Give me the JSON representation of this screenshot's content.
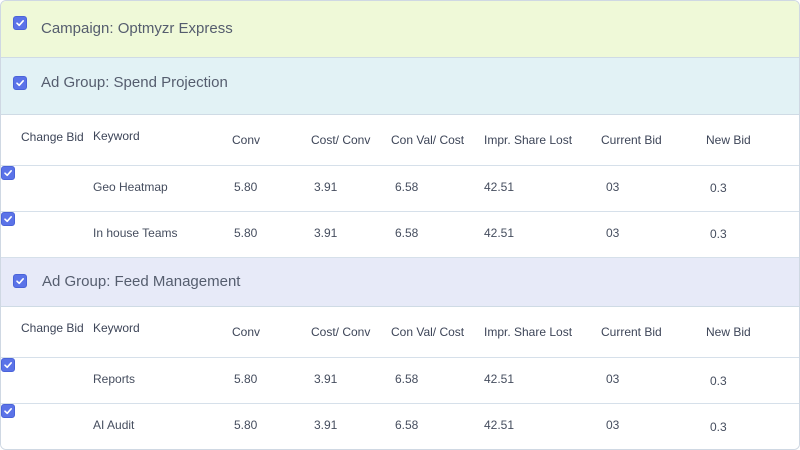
{
  "campaign": {
    "title": "Campaign: Optmyzr Express",
    "checked": true,
    "color": "#eff9d8"
  },
  "columns": {
    "change_bid": "Change Bid",
    "keyword": "Keyword",
    "conv": "Conv",
    "cost_conv": "Cost/ Conv",
    "con_val_cost": "Con Val/ Cost",
    "impr_share_lost": "Impr. Share Lost",
    "current_bid": "Current Bid",
    "new_bid": "New Bid"
  },
  "ad_groups": [
    {
      "title": "Ad Group: Spend Projection",
      "checked": true,
      "color": "#e2f2f5",
      "rows": [
        {
          "checked": true,
          "keyword": "Geo Heatmap",
          "conv": "5.80",
          "cost_conv": "3.91",
          "con_val_cost": "6.58",
          "impr_share_lost": "42.51",
          "current_bid": "03",
          "new_bid": "0.3"
        },
        {
          "checked": true,
          "keyword": "In house Teams",
          "conv": "5.80",
          "cost_conv": "3.91",
          "con_val_cost": "6.58",
          "impr_share_lost": "42.51",
          "current_bid": "03",
          "new_bid": "0.3"
        }
      ]
    },
    {
      "title": "Ad Group: Feed Management",
      "checked": true,
      "color": "#e7eaf8",
      "rows": [
        {
          "checked": true,
          "keyword": "Reports",
          "conv": "5.80",
          "cost_conv": "3.91",
          "con_val_cost": "6.58",
          "impr_share_lost": "42.51",
          "current_bid": "03",
          "new_bid": "0.3"
        },
        {
          "checked": true,
          "keyword": "AI Audit",
          "conv": "5.80",
          "cost_conv": "3.91",
          "con_val_cost": "6.58",
          "impr_share_lost": "42.51",
          "current_bid": "03",
          "new_bid": "0.3"
        }
      ]
    }
  ],
  "colors": {
    "checkbox": "#5b73e8",
    "divider": "#d6e0ea"
  },
  "icons": {
    "checkbox": "checkmark-icon"
  }
}
